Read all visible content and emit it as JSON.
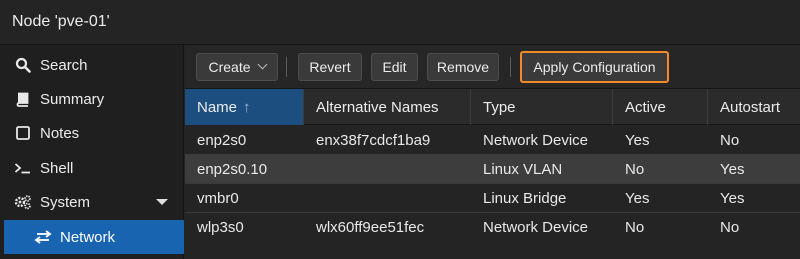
{
  "window": {
    "title": "Node 'pve-01'"
  },
  "sidebar": {
    "items": [
      {
        "label": "Search",
        "icon": "search-icon"
      },
      {
        "label": "Summary",
        "icon": "book-icon"
      },
      {
        "label": "Notes",
        "icon": "note-icon"
      },
      {
        "label": "Shell",
        "icon": "terminal-icon"
      },
      {
        "label": "System",
        "icon": "gears-icon"
      },
      {
        "label": "Network",
        "icon": "exchange-icon"
      }
    ]
  },
  "toolbar": {
    "create_label": "Create",
    "revert_label": "Revert",
    "edit_label": "Edit",
    "remove_label": "Remove",
    "apply_label": "Apply Configuration"
  },
  "grid": {
    "columns": [
      "Name",
      "Alternative Names",
      "Type",
      "Active",
      "Autostart"
    ],
    "sort_indicator": "↑",
    "rows": [
      [
        "enp2s0",
        "enx38f7cdcf1ba9",
        "Network Device",
        "Yes",
        "No"
      ],
      [
        "enp2s0.10",
        "",
        "Linux VLAN",
        "No",
        "Yes"
      ],
      [
        "vmbr0",
        "",
        "Linux Bridge",
        "Yes",
        "Yes"
      ],
      [
        "wlp3s0",
        "wlx60ff9ee51fec",
        "Network Device",
        "No",
        "No"
      ]
    ]
  },
  "colors": {
    "selected_nav": "#1864b0",
    "sorted_header": "#1c4f80",
    "apply_highlight": "#f08c28"
  }
}
